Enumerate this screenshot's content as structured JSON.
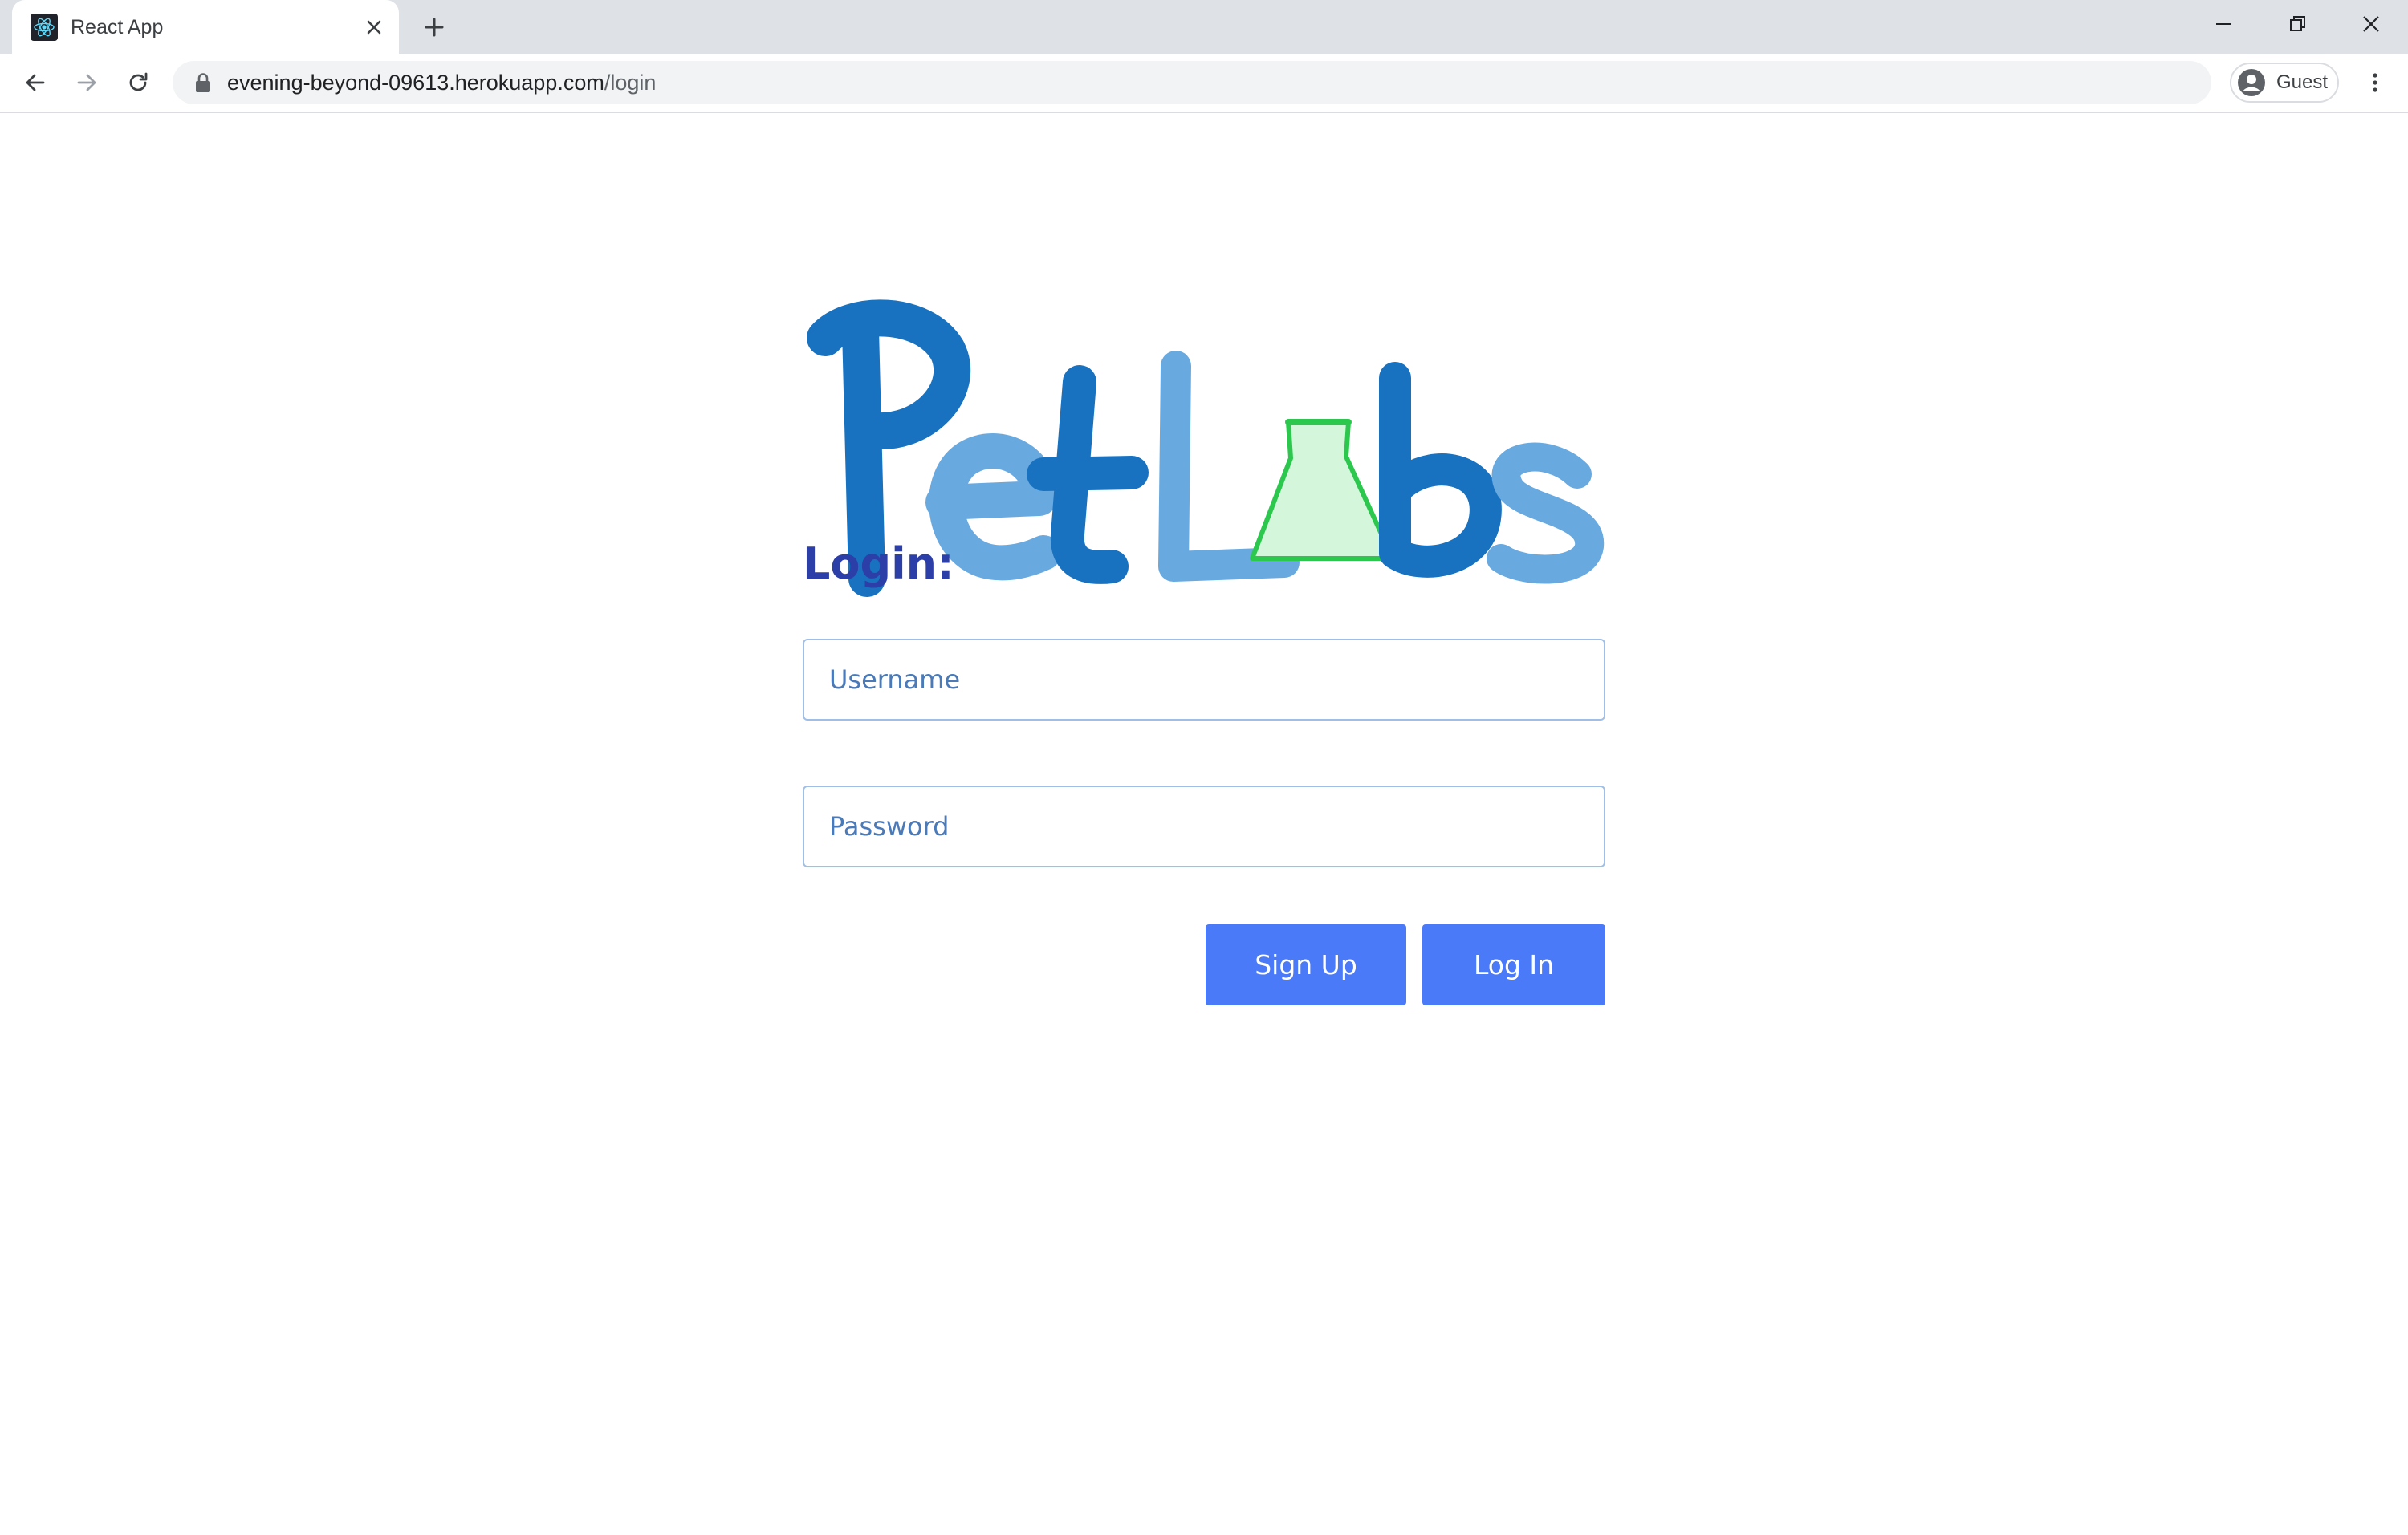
{
  "browser": {
    "tab": {
      "title": "React App",
      "favicon": "react-icon"
    },
    "address_bar": {
      "host": "evening-beyond-09613.herokuapp.com",
      "path": "/login"
    },
    "profile": {
      "label": "Guest"
    },
    "icons": {
      "back": "arrow-left-icon",
      "forward": "arrow-right-icon",
      "reload": "reload-icon",
      "lock": "lock-icon",
      "menu": "kebab-menu-icon",
      "new_tab": "plus-icon",
      "close_tab": "close-icon"
    }
  },
  "page": {
    "logo_alt": "PetLabs",
    "heading": "Login:",
    "username": {
      "placeholder": "Username",
      "value": ""
    },
    "password": {
      "placeholder": "Password",
      "value": ""
    },
    "signup_label": "Sign Up",
    "login_label": "Log In"
  },
  "colors": {
    "heading": "#2c3ea8",
    "button": "#4a7af7",
    "logo_dark_blue": "#1872c0",
    "logo_light_blue": "#68a9e0",
    "logo_flask_green": "#2cc84e"
  }
}
